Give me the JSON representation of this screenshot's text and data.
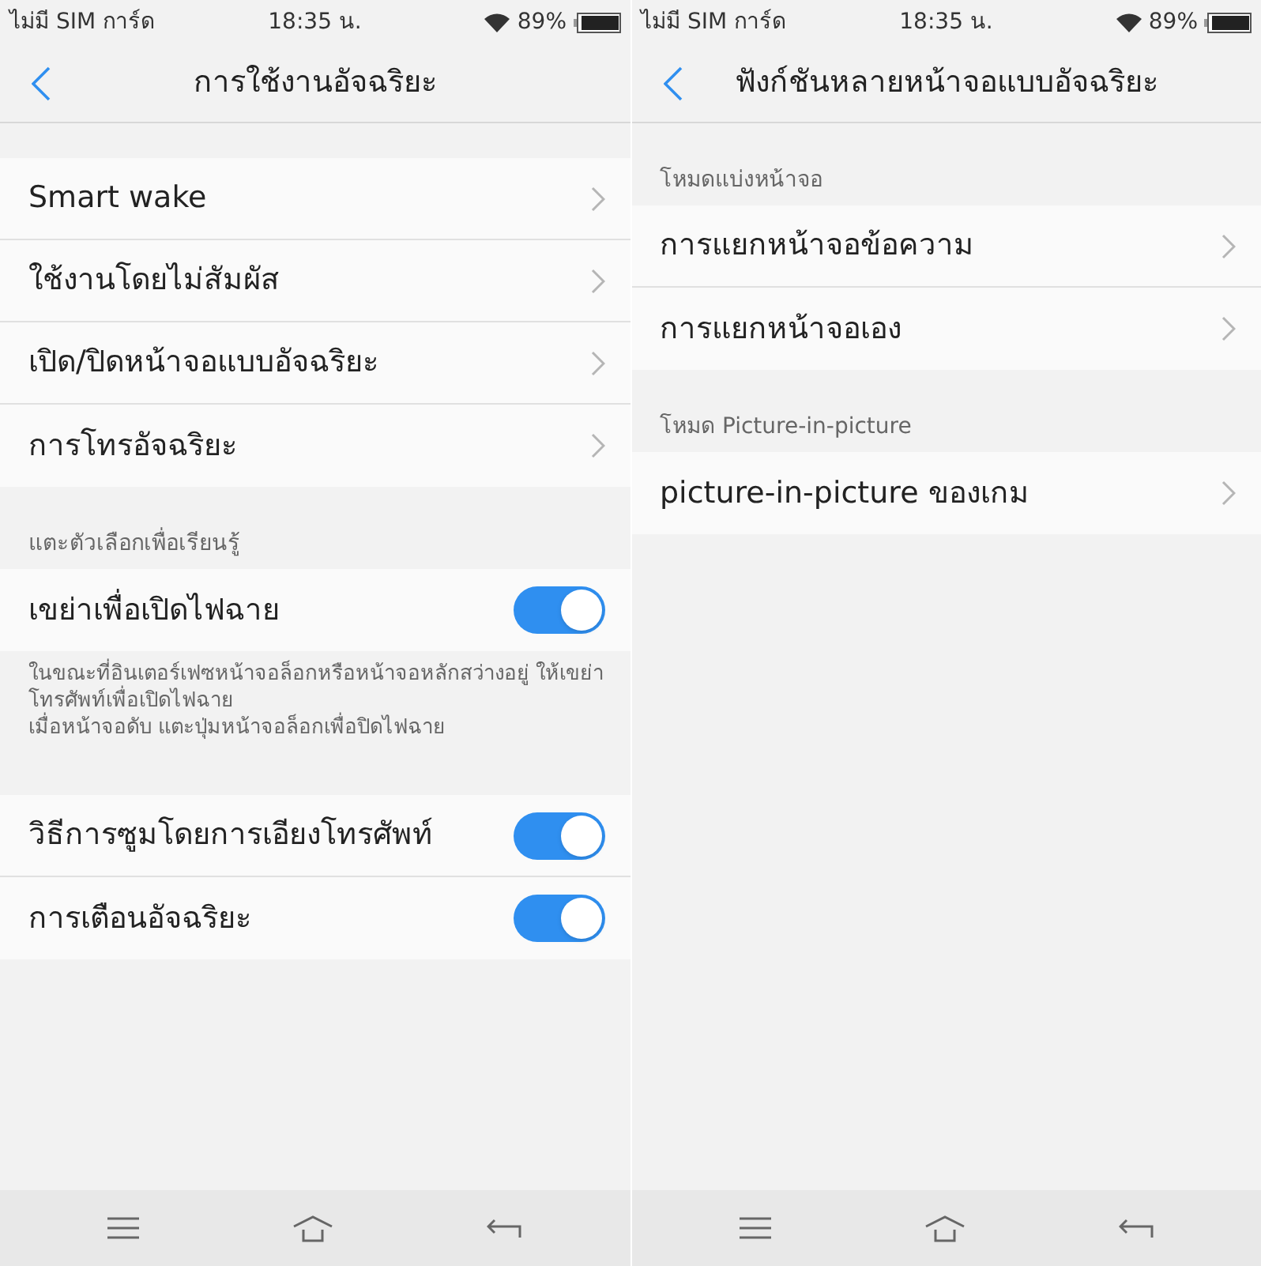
{
  "screens": [
    {
      "status_bar": {
        "carrier": "ไม่มี SIM การ์ด",
        "time": "18:35 น.",
        "battery": "89%"
      },
      "title": "การใช้งานอัจฉริยะ",
      "sections": [
        {
          "items": [
            {
              "kind": "link",
              "label": "Smart wake"
            },
            {
              "kind": "link",
              "label": "ใช้งานโดยไม่สัมผัส"
            },
            {
              "kind": "link",
              "label": "เปิด/ปิดหน้าจอแบบอัจฉริยะ"
            },
            {
              "kind": "link",
              "label": "การโทรอัจฉริยะ"
            }
          ]
        },
        {
          "header": "แตะตัวเลือกเพื่อเรียนรู้",
          "items": [
            {
              "kind": "toggle",
              "label": "เขย่าเพื่อเปิดไฟฉาย",
              "on": true
            }
          ],
          "footer": [
            "ในขณะที่อินเตอร์เฟซหน้าจอล็อกหรือหน้าจอหลักสว่างอยู่ ให้เขย่าโทรศัพท์เพื่อเปิดไฟฉาย",
            "เมื่อหน้าจอดับ แตะปุ่มหน้าจอล็อกเพื่อปิดไฟฉาย"
          ]
        },
        {
          "items": [
            {
              "kind": "toggle",
              "label": "วิธีการซูมโดยการเอียงโทรศัพท์",
              "on": true
            },
            {
              "kind": "toggle",
              "label": "การเตือนอัจฉริยะ",
              "on": true
            }
          ]
        }
      ]
    },
    {
      "status_bar": {
        "carrier": "ไม่มี SIM การ์ด",
        "time": "18:35 น.",
        "battery": "89%"
      },
      "title": "ฟังก์ชันหลายหน้าจอแบบอัจฉริยะ",
      "sections": [
        {
          "header": "โหมดแบ่งหน้าจอ",
          "items": [
            {
              "kind": "link",
              "label": "การแยกหน้าจอข้อความ"
            },
            {
              "kind": "link",
              "label": "การแยกหน้าจอเอง"
            }
          ]
        },
        {
          "header": "โหมด Picture-in-picture",
          "items": [
            {
              "kind": "link",
              "label": "picture-in-picture ของเกม"
            }
          ]
        }
      ]
    }
  ]
}
